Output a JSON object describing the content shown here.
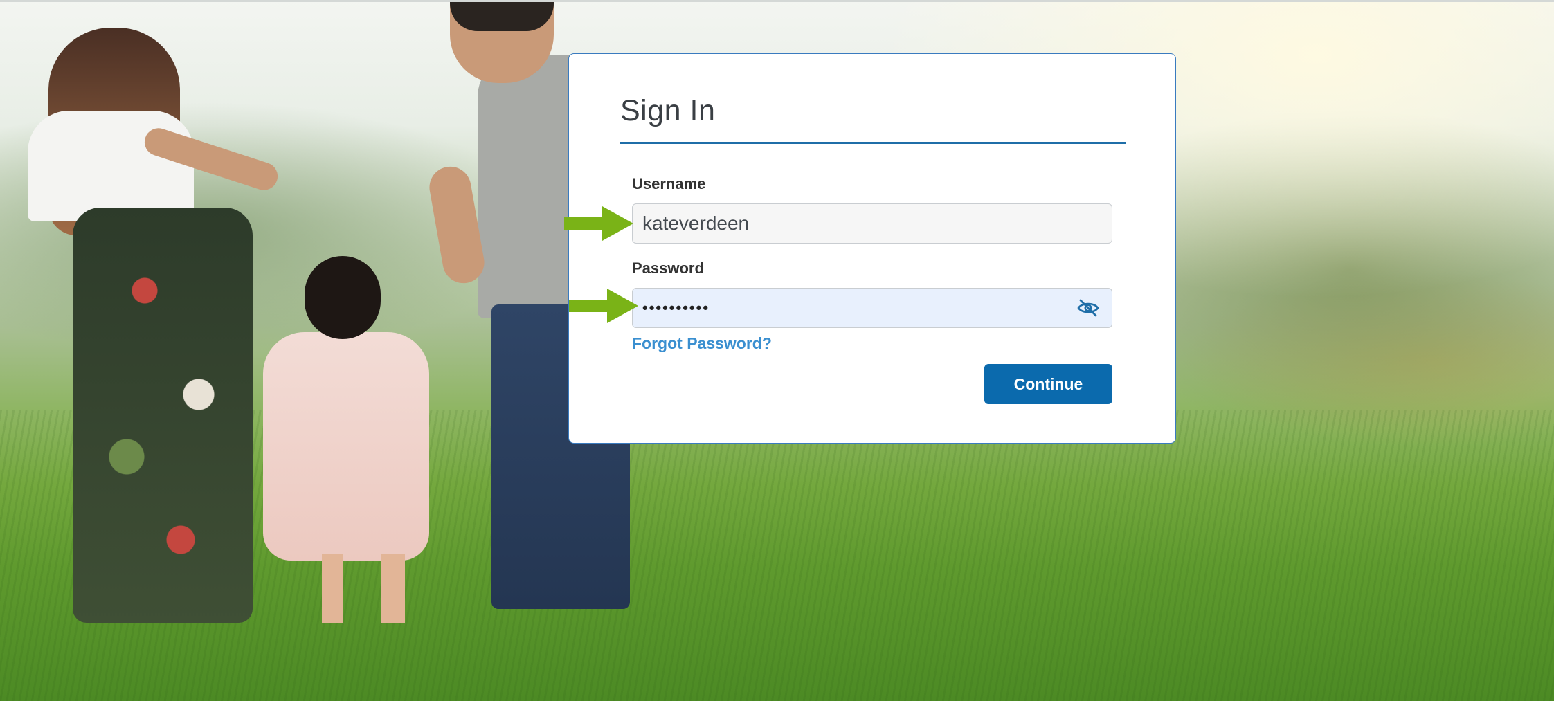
{
  "signin": {
    "title": "Sign In",
    "username_label": "Username",
    "username_value": "kateverdeen",
    "password_label": "Password",
    "password_masked": "••••••••••",
    "forgot_label": "Forgot Password?",
    "continue_label": "Continue"
  },
  "icons": {
    "password_toggle": "eye-slash-icon",
    "annotation": "arrow-right-icon"
  },
  "colors": {
    "accent": "#0b6aad",
    "link": "#3a8fd0",
    "title_rule": "#1f6ea8",
    "annotation_arrow": "#7ab317",
    "password_field_bg": "#e8f0fd"
  }
}
